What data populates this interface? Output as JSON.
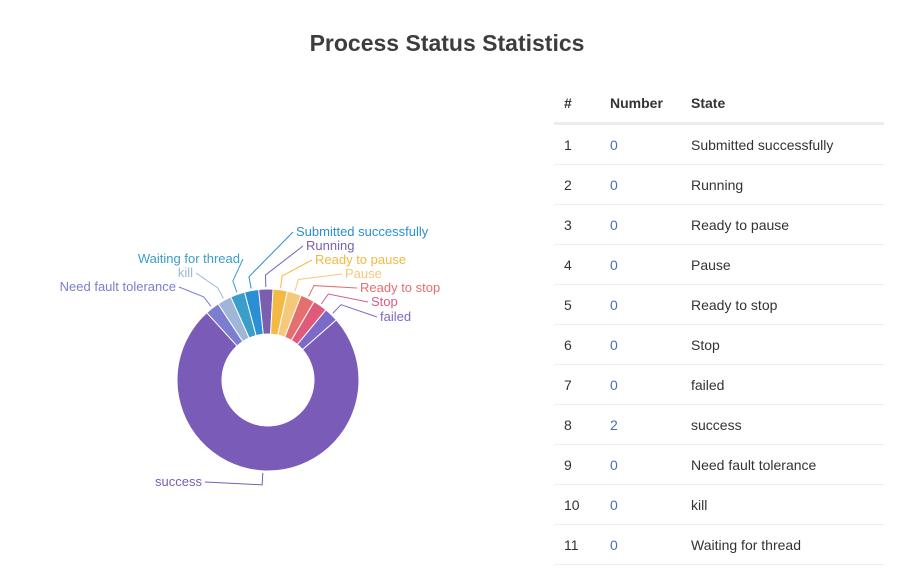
{
  "title": "Process Status Statistics",
  "table": {
    "headers": [
      "#",
      "Number",
      "State"
    ],
    "rows": [
      {
        "index": "1",
        "number": "0",
        "state": "Submitted successfully"
      },
      {
        "index": "2",
        "number": "0",
        "state": "Running"
      },
      {
        "index": "3",
        "number": "0",
        "state": "Ready to pause"
      },
      {
        "index": "4",
        "number": "0",
        "state": "Pause"
      },
      {
        "index": "5",
        "number": "0",
        "state": "Ready to stop"
      },
      {
        "index": "6",
        "number": "0",
        "state": "Stop"
      },
      {
        "index": "7",
        "number": "0",
        "state": "failed"
      },
      {
        "index": "8",
        "number": "2",
        "state": "success"
      },
      {
        "index": "9",
        "number": "0",
        "state": "Need fault tolerance"
      },
      {
        "index": "10",
        "number": "0",
        "state": "kill"
      },
      {
        "index": "11",
        "number": "0",
        "state": "Waiting for thread"
      }
    ]
  },
  "chart_data": {
    "type": "pie",
    "donut": true,
    "legend": "none",
    "categories": [
      "Submitted successfully",
      "Running",
      "Ready to pause",
      "Pause",
      "Ready to stop",
      "Stop",
      "failed",
      "success",
      "Need fault tolerance",
      "kill",
      "Waiting for thread"
    ],
    "values": [
      0,
      0,
      0,
      0,
      0,
      0,
      0,
      2,
      0,
      0,
      0
    ],
    "colors": [
      "#2a8fd4",
      "#7a5fb0",
      "#f4b942",
      "#f6c87a",
      "#e46f6f",
      "#e05b7a",
      "#7c6ac9",
      "#7a5cb8",
      "#7b7ed0",
      "#9fb6d6",
      "#3b9ec9"
    ]
  }
}
